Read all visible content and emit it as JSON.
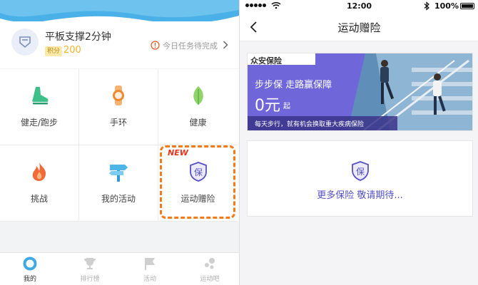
{
  "left": {
    "task": {
      "title": "平板支撑2分钟",
      "points_badge": "积分",
      "points_value": "200",
      "pending_text": "今日任务待完成"
    },
    "grid": [
      {
        "label": "健走/跑步",
        "icon": "shoe-icon"
      },
      {
        "label": "手环",
        "icon": "band-icon"
      },
      {
        "label": "健康",
        "icon": "leaf-icon"
      },
      {
        "label": "挑战",
        "icon": "flame-icon"
      },
      {
        "label": "我的活动",
        "icon": "signpost-icon"
      },
      {
        "label": "运动赠险",
        "icon": "shield-icon"
      }
    ],
    "new_tag": "NEW",
    "tabs": [
      {
        "label": "我的",
        "icon": "ring-icon",
        "active": true
      },
      {
        "label": "排行榜",
        "icon": "trophy-icon",
        "active": false
      },
      {
        "label": "活动",
        "icon": "flag-icon",
        "active": false
      },
      {
        "label": "运动吧",
        "icon": "bubbles-icon",
        "active": false
      }
    ],
    "colors": {
      "wave": "#4ab1e8",
      "highlight": "#f47a18",
      "new": "#e8341c"
    }
  },
  "right": {
    "status": {
      "time": "12:00",
      "battery": "100%"
    },
    "nav": {
      "title": "运动赠险"
    },
    "banner": {
      "brand": "众安保险",
      "title": "步步保 走路赢保障",
      "price": "0元",
      "price_suffix": "起",
      "caption": "每天步行，就有机会换取重大疾病保险"
    },
    "more": {
      "text": "更多保险 敬请期待..."
    },
    "colors": {
      "accent": "#5551c4",
      "banner": "#6f67d9"
    }
  }
}
